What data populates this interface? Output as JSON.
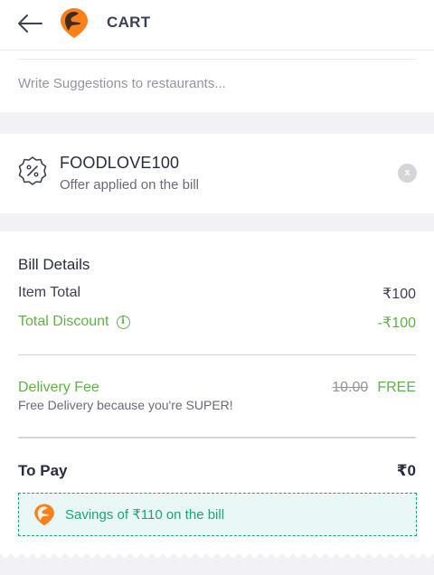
{
  "header": {
    "title": "CART",
    "back_icon": "arrow-left-icon",
    "logo_icon": "swiggy-logo-icon"
  },
  "suggestions": {
    "placeholder": "Write Suggestions to restaurants..."
  },
  "offer": {
    "icon": "percent-badge-icon",
    "code": "FOODLOVE100",
    "subtitle": "Offer applied on the bill",
    "remove_label": "x"
  },
  "bill": {
    "title": "Bill Details",
    "item_total_label": "Item Total",
    "item_total_value": "₹100",
    "discount_label": "Total Discount",
    "discount_info_icon": "i",
    "discount_value": "-₹100",
    "delivery_fee_label": "Delivery Fee",
    "delivery_fee_sub": "Free Delivery because you're SUPER!",
    "delivery_fee_original": "10.00",
    "delivery_fee_value": "FREE",
    "to_pay_label": "To Pay",
    "to_pay_value": "₹0"
  },
  "savings": {
    "text": "Savings of ₹110 on the bill"
  },
  "colors": {
    "brand_orange": "#fc8019",
    "success_green": "#60b246",
    "savings_teal": "#1ba672",
    "text_dark": "#282c3f",
    "text_muted": "#686b78",
    "section_gap": "#f1f1f6"
  }
}
